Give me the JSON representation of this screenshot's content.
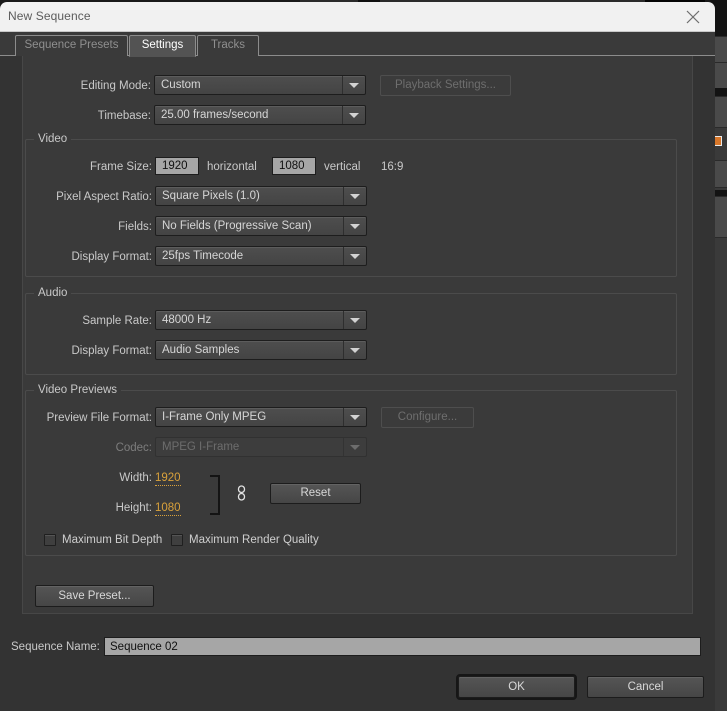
{
  "window": {
    "title": "New Sequence",
    "close_icon": "close-icon"
  },
  "tabs": [
    {
      "id": "sequence-presets",
      "label": "Sequence Presets",
      "active": false
    },
    {
      "id": "settings",
      "label": "Settings",
      "active": true
    },
    {
      "id": "tracks",
      "label": "Tracks",
      "active": false
    }
  ],
  "settings": {
    "editing_mode": {
      "label": "Editing Mode:",
      "value": "Custom"
    },
    "playback_settings_button": "Playback Settings...",
    "timebase": {
      "label": "Timebase:",
      "value": "25.00 frames/second"
    },
    "video": {
      "legend": "Video",
      "frame_size": {
        "label": "Frame Size:",
        "horizontal_value": "1920",
        "horizontal_label": "horizontal",
        "vertical_value": "1080",
        "vertical_label": "vertical",
        "aspect_ratio": "16:9"
      },
      "pixel_aspect_ratio": {
        "label": "Pixel Aspect Ratio:",
        "value": "Square Pixels (1.0)"
      },
      "fields": {
        "label": "Fields:",
        "value": "No Fields (Progressive Scan)"
      },
      "display_format": {
        "label": "Display Format:",
        "value": "25fps Timecode"
      }
    },
    "audio": {
      "legend": "Audio",
      "sample_rate": {
        "label": "Sample Rate:",
        "value": "48000 Hz"
      },
      "display_format": {
        "label": "Display Format:",
        "value": "Audio Samples"
      }
    },
    "video_previews": {
      "legend": "Video Previews",
      "preview_file_format": {
        "label": "Preview File Format:",
        "value": "I-Frame Only MPEG"
      },
      "configure_button": "Configure...",
      "codec": {
        "label": "Codec:",
        "value": "MPEG I-Frame"
      },
      "width": {
        "label": "Width:",
        "value": "1920"
      },
      "height": {
        "label": "Height:",
        "value": "1080"
      },
      "link_icon": "chain-link-icon",
      "reset_button": "Reset",
      "max_bit_depth": {
        "label": "Maximum Bit Depth",
        "checked": false
      },
      "max_render_quality": {
        "label": "Maximum Render Quality",
        "checked": false
      }
    },
    "save_preset_button": "Save Preset..."
  },
  "footer": {
    "sequence_name_label": "Sequence Name:",
    "sequence_name_value": "Sequence 02",
    "ok_button": "OK",
    "cancel_button": "Cancel"
  },
  "colors": {
    "dialog_bg": "#333333",
    "panel_bg": "#3a3a3a",
    "titlebar_bg": "#f1f1f1",
    "hot_text": "#d9a13b",
    "field_bg": "#a6a6a6",
    "accent_orange": "#d8772a"
  }
}
